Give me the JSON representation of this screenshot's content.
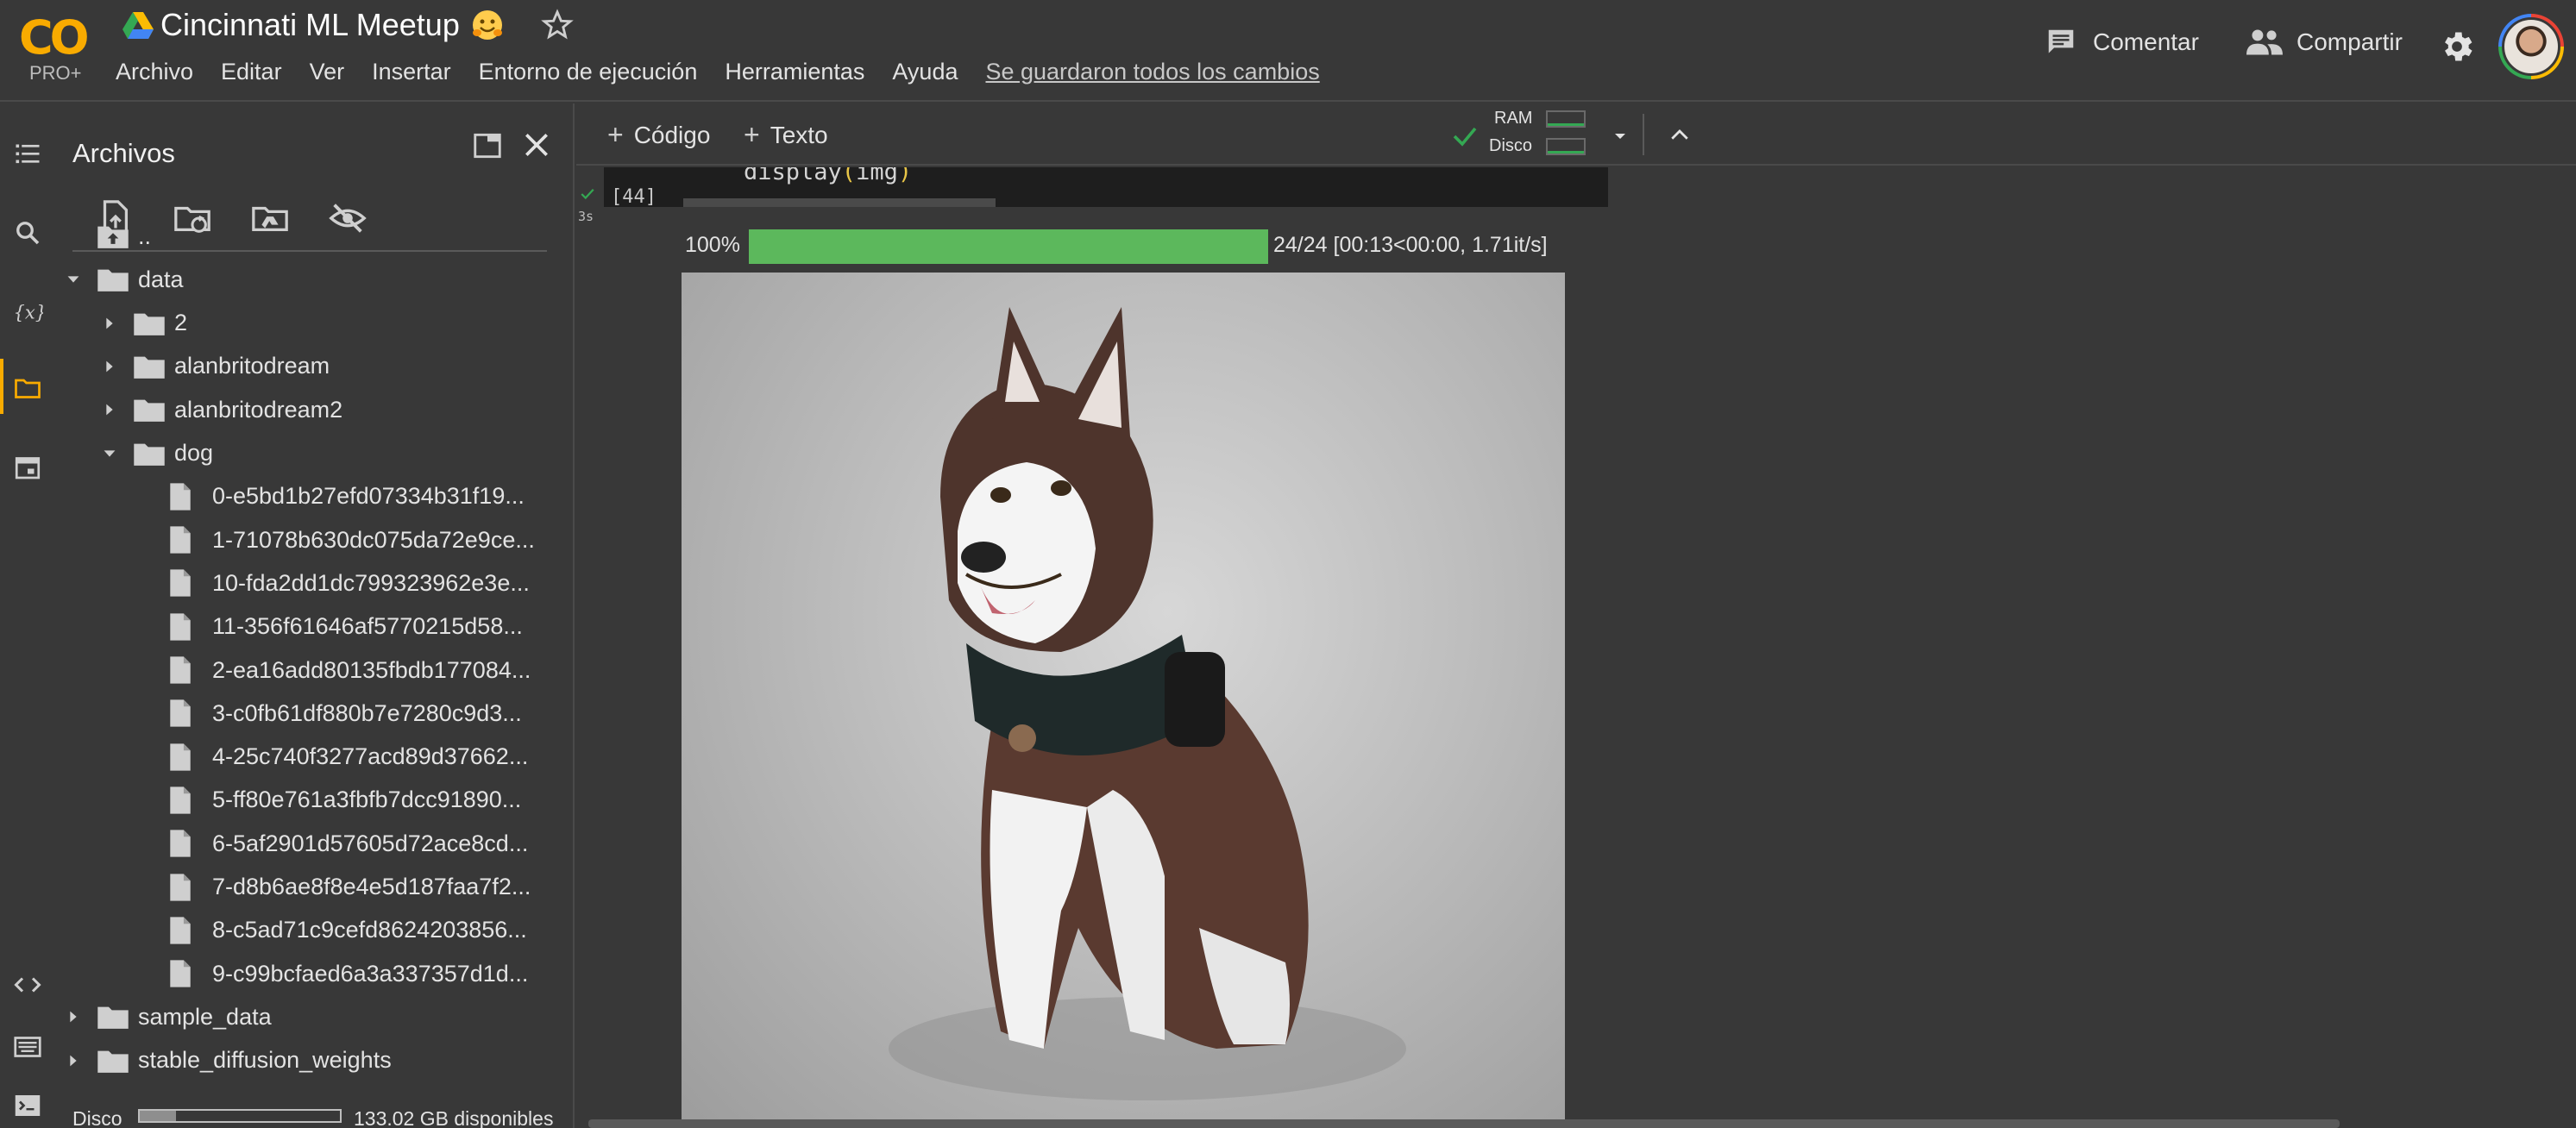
{
  "app": {
    "logo_text": "CO",
    "logo_sub": "PRO+",
    "title": "Cincinnati ML Meetup",
    "title_emoji": "hugging-face-emoji"
  },
  "menu": [
    "Archivo",
    "Editar",
    "Ver",
    "Insertar",
    "Entorno de ejecución",
    "Herramientas",
    "Ayuda"
  ],
  "save_status": "Se guardaron todos los cambios",
  "header_actions": {
    "comment_label": "Comentar",
    "share_label": "Compartir"
  },
  "files_panel": {
    "title": "Archivos",
    "tree": [
      {
        "label": "..",
        "kind": "parent",
        "depth": 0,
        "expand": "none"
      },
      {
        "label": "data",
        "kind": "folder",
        "depth": 0,
        "expand": "open"
      },
      {
        "label": "2",
        "kind": "folder",
        "depth": 1,
        "expand": "closed"
      },
      {
        "label": "alanbritodream",
        "kind": "folder",
        "depth": 1,
        "expand": "closed"
      },
      {
        "label": "alanbritodream2",
        "kind": "folder",
        "depth": 1,
        "expand": "closed"
      },
      {
        "label": "dog",
        "kind": "folder",
        "depth": 1,
        "expand": "open"
      },
      {
        "label": "0-e5bd1b27efd07334b31f19...",
        "kind": "file",
        "depth": 2,
        "expand": "none"
      },
      {
        "label": "1-71078b630dc075da72e9ce...",
        "kind": "file",
        "depth": 2,
        "expand": "none"
      },
      {
        "label": "10-fda2dd1dc799323962e3e...",
        "kind": "file",
        "depth": 2,
        "expand": "none"
      },
      {
        "label": "11-356f61646af5770215d58...",
        "kind": "file",
        "depth": 2,
        "expand": "none"
      },
      {
        "label": "2-ea16add80135fbdb177084...",
        "kind": "file",
        "depth": 2,
        "expand": "none"
      },
      {
        "label": "3-c0fb61df880b7e7280c9d3...",
        "kind": "file",
        "depth": 2,
        "expand": "none"
      },
      {
        "label": "4-25c740f3277acd89d37662...",
        "kind": "file",
        "depth": 2,
        "expand": "none"
      },
      {
        "label": "5-ff80e761a3fbfb7dcc91890...",
        "kind": "file",
        "depth": 2,
        "expand": "none"
      },
      {
        "label": "6-5af2901d57605d72ace8cd...",
        "kind": "file",
        "depth": 2,
        "expand": "none"
      },
      {
        "label": "7-d8b6ae8f8e4e5d187faa7f2...",
        "kind": "file",
        "depth": 2,
        "expand": "none"
      },
      {
        "label": "8-c5ad71c9cefd8624203856...",
        "kind": "file",
        "depth": 2,
        "expand": "none"
      },
      {
        "label": "9-c99bcfaed6a3a337357d1d...",
        "kind": "file",
        "depth": 2,
        "expand": "none"
      },
      {
        "label": "sample_data",
        "kind": "folder",
        "depth": 0,
        "expand": "closed"
      },
      {
        "label": "stable_diffusion_weights",
        "kind": "folder",
        "depth": 0,
        "expand": "closed"
      }
    ],
    "disk_label": "Disco",
    "disk_used_fraction": 0.18,
    "disk_free_text": "133.02 GB disponibles"
  },
  "toolbar": {
    "add_code_label": "Código",
    "add_text_label": "Texto",
    "ram_label": "RAM",
    "disk_label": "Disco"
  },
  "cell": {
    "code": [
      "display",
      "(",
      "img",
      ")"
    ],
    "exec_count": "[44]",
    "exec_time": "3s"
  },
  "output": {
    "progress_percent_text": "100%",
    "progress_value": 1.0,
    "progress_stats": "24/24 [00:13<00:00, 1.71it/s]",
    "image_subject": "husky-dog-image"
  },
  "colors": {
    "background": "#383838",
    "accent": "#f9ab00",
    "progress": "#5cb85c",
    "code_bg": "#1e1e1e"
  }
}
